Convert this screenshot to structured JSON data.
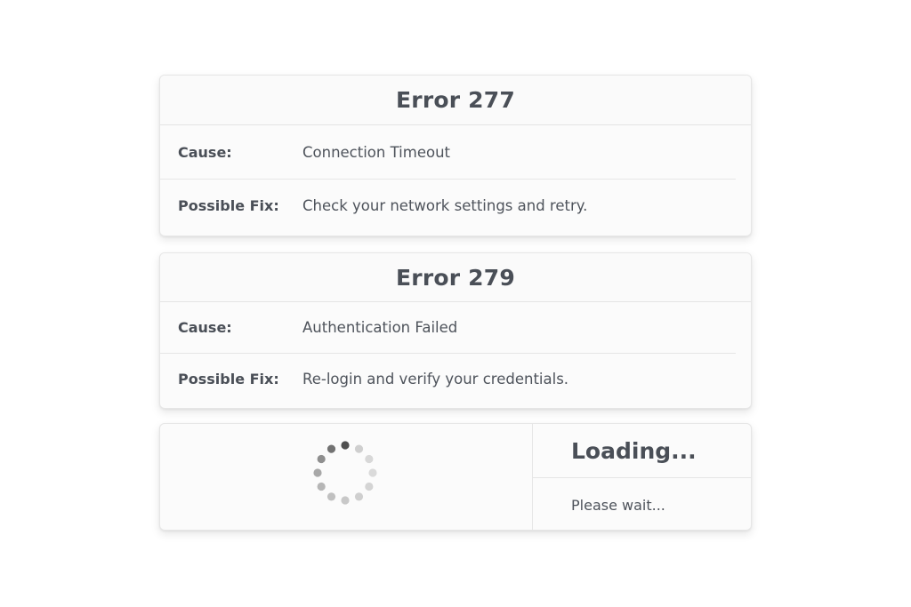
{
  "errors": [
    {
      "title": "Error 277",
      "cause_label": "Cause:",
      "cause_value": "Connection Timeout",
      "fix_label": "Possible Fix:",
      "fix_value": "Check your network settings and retry."
    },
    {
      "title": "Error 279",
      "cause_label": "Cause:",
      "cause_value": "Authentication Failed",
      "fix_label": "Possible Fix:",
      "fix_value": "Re-login and verify your credentials."
    }
  ],
  "loading": {
    "title": "Loading...",
    "subtitle": "Please wait...",
    "spinner_icon": "loading-spinner-icon"
  },
  "colors": {
    "text": "#4a4f57",
    "card_bg": "#fbfbfb",
    "divider": "#e6e6e6",
    "spinner_dark": "#555555",
    "spinner_light": "#dddddd"
  }
}
